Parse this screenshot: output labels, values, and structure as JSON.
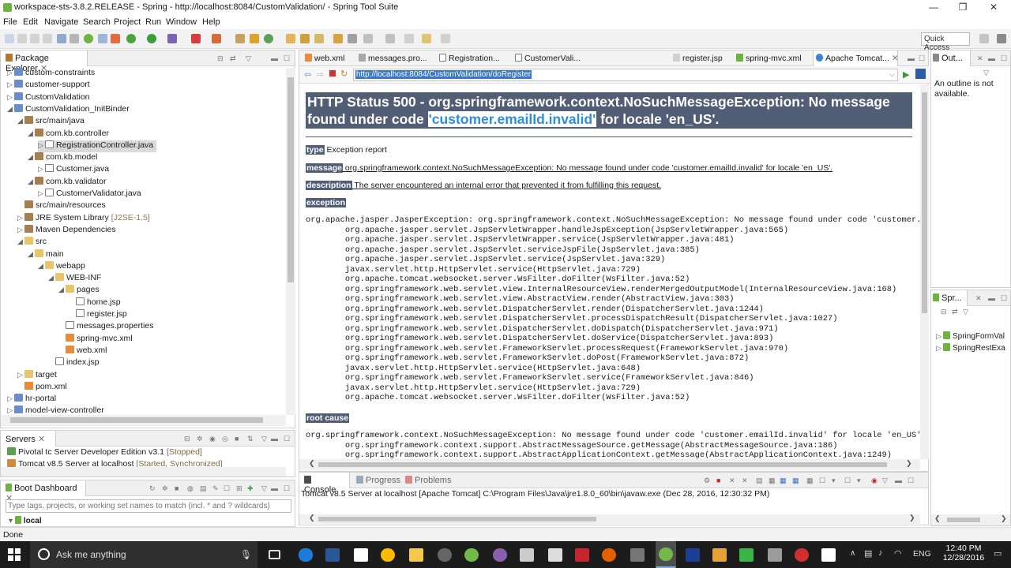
{
  "window": {
    "title": "workspace-sts-3.8.2.RELEASE - Spring - http://localhost:8084/CustomValidation/ - Spring Tool Suite"
  },
  "menu": [
    "File",
    "Edit",
    "Navigate",
    "Search",
    "Project",
    "Run",
    "Window",
    "Help"
  ],
  "toolbar": {
    "quick_access": "Quick Access"
  },
  "package_explorer": {
    "title": "Package Explorer",
    "items": [
      {
        "label": "custom-constraints",
        "depth": 0,
        "icon": "project-icon",
        "tw": "▷"
      },
      {
        "label": "customer-support",
        "depth": 0,
        "icon": "project-icon",
        "tw": "▷"
      },
      {
        "label": "CustomValidation",
        "depth": 0,
        "icon": "project-icon",
        "tw": "▷"
      },
      {
        "label": "CustomValidation_InitBinder",
        "depth": 0,
        "icon": "project-icon",
        "tw": "◢"
      },
      {
        "label": "src/main/java",
        "depth": 1,
        "icon": "source-folder-icon",
        "tw": "◢"
      },
      {
        "label": "com.kb.controller",
        "depth": 2,
        "icon": "package-icon",
        "tw": "◢"
      },
      {
        "label": "RegistrationController.java",
        "depth": 3,
        "icon": "java-file-icon",
        "tw": "▷",
        "selected": true
      },
      {
        "label": "com.kb.model",
        "depth": 2,
        "icon": "package-icon",
        "tw": "◢"
      },
      {
        "label": "Customer.java",
        "depth": 3,
        "icon": "java-file-icon",
        "tw": "▷"
      },
      {
        "label": "com.kb.validator",
        "depth": 2,
        "icon": "package-icon",
        "tw": "◢"
      },
      {
        "label": "CustomerValidator.java",
        "depth": 3,
        "icon": "java-file-icon",
        "tw": "▷"
      },
      {
        "label": "src/main/resources",
        "depth": 1,
        "icon": "source-folder-icon",
        "tw": ""
      },
      {
        "label": "JRE System Library",
        "suffix": "[J2SE-1.5]",
        "depth": 1,
        "icon": "library-icon",
        "tw": "▷"
      },
      {
        "label": "Maven Dependencies",
        "depth": 1,
        "icon": "library-icon",
        "tw": "▷"
      },
      {
        "label": "src",
        "depth": 1,
        "icon": "folder-icon",
        "tw": "◢"
      },
      {
        "label": "main",
        "depth": 2,
        "icon": "folder-icon",
        "tw": "◢"
      },
      {
        "label": "webapp",
        "depth": 3,
        "icon": "folder-icon",
        "tw": "◢"
      },
      {
        "label": "WEB-INF",
        "depth": 4,
        "icon": "folder-icon",
        "tw": "◢"
      },
      {
        "label": "pages",
        "depth": 5,
        "icon": "folder-icon",
        "tw": "◢"
      },
      {
        "label": "home.jsp",
        "depth": 6,
        "icon": "jsp-file-icon",
        "tw": ""
      },
      {
        "label": "register.jsp",
        "depth": 6,
        "icon": "jsp-file-icon",
        "tw": ""
      },
      {
        "label": "messages.properties",
        "depth": 5,
        "icon": "properties-file-icon",
        "tw": ""
      },
      {
        "label": "spring-mvc.xml",
        "depth": 5,
        "icon": "xml-file-icon",
        "tw": ""
      },
      {
        "label": "web.xml",
        "depth": 5,
        "icon": "xml-file-icon",
        "tw": ""
      },
      {
        "label": "index.jsp",
        "depth": 4,
        "icon": "jsp-file-icon",
        "tw": ""
      },
      {
        "label": "target",
        "depth": 1,
        "icon": "folder-icon",
        "tw": "▷"
      },
      {
        "label": "pom.xml",
        "depth": 1,
        "icon": "xml-file-icon",
        "tw": ""
      },
      {
        "label": "hr-portal",
        "depth": 0,
        "icon": "project-icon",
        "tw": "▷"
      },
      {
        "label": "model-view-controller",
        "depth": 0,
        "icon": "project-icon",
        "tw": "▷"
      }
    ]
  },
  "servers": {
    "title": "Servers",
    "items": [
      {
        "label": "Pivotal tc Server Developer Edition v3.1",
        "status": "[Stopped]"
      },
      {
        "label": "Tomcat v8.5 Server at localhost",
        "status": "[Started, Synchronized]"
      }
    ]
  },
  "boot_dashboard": {
    "title": "Boot Dashboard",
    "filter_placeholder": "Type tags, projects, or working set names to match (incl. * and ? wildcards)",
    "item": "local"
  },
  "editor": {
    "tabs": [
      "web.xml",
      "messages.pro...",
      "Registration...",
      "CustomerVali...",
      "register.jsp",
      "spring-mvc.xml",
      "Apache Tomcat..."
    ],
    "url": "http://localhost:8084/CustomValidation/doRegister",
    "heading_pre": "HTTP Status 500 - org.springframework.context.NoSuchMessageException: No message found under code ",
    "heading_code": "'customer.emailId.invalid'",
    "heading_post": " for locale 'en_US'.",
    "type_label": "type",
    "type_value": " Exception report",
    "message_label": "message",
    "message_value": " org.springframework.context.NoSuchMessageException: No message found under code 'customer.emailId.invalid' for locale 'en_US'.",
    "description_label": "description",
    "description_value": " The server encountered an internal error that prevented it from fulfilling this request.",
    "exception_label": "exception",
    "exception_trace": "org.apache.jasper.JasperException: org.springframework.context.NoSuchMessageException: No message found under code 'customer.emailId.invalid' for locale 'en_US'.\n\torg.apache.jasper.servlet.JspServletWrapper.handleJspException(JspServletWrapper.java:565)\n\torg.apache.jasper.servlet.JspServletWrapper.service(JspServletWrapper.java:481)\n\torg.apache.jasper.servlet.JspServlet.serviceJspFile(JspServlet.java:385)\n\torg.apache.jasper.servlet.JspServlet.service(JspServlet.java:329)\n\tjavax.servlet.http.HttpServlet.service(HttpServlet.java:729)\n\torg.apache.tomcat.websocket.server.WsFilter.doFilter(WsFilter.java:52)\n\torg.springframework.web.servlet.view.InternalResourceView.renderMergedOutputModel(InternalResourceView.java:168)\n\torg.springframework.web.servlet.view.AbstractView.render(AbstractView.java:303)\n\torg.springframework.web.servlet.DispatcherServlet.render(DispatcherServlet.java:1244)\n\torg.springframework.web.servlet.DispatcherServlet.processDispatchResult(DispatcherServlet.java:1027)\n\torg.springframework.web.servlet.DispatcherServlet.doDispatch(DispatcherServlet.java:971)\n\torg.springframework.web.servlet.DispatcherServlet.doService(DispatcherServlet.java:893)\n\torg.springframework.web.servlet.FrameworkServlet.processRequest(FrameworkServlet.java:970)\n\torg.springframework.web.servlet.FrameworkServlet.doPost(FrameworkServlet.java:872)\n\tjavax.servlet.http.HttpServlet.service(HttpServlet.java:648)\n\torg.springframework.web.servlet.FrameworkServlet.service(FrameworkServlet.java:846)\n\tjavax.servlet.http.HttpServlet.service(HttpServlet.java:729)\n\torg.apache.tomcat.websocket.server.WsFilter.doFilter(WsFilter.java:52)",
    "root_cause_label": "root cause",
    "root_trace": "org.springframework.context.NoSuchMessageException: No message found under code 'customer.emailId.invalid' for locale 'en_US'.\n\torg.springframework.context.support.AbstractMessageSource.getMessage(AbstractMessageSource.java:186)\n\torg.springframework.context.support.AbstractApplicationContext.getMessage(AbstractApplicationContext.java:1249)"
  },
  "outline": {
    "title": "Out...",
    "text": "An outline is not available."
  },
  "spring_panel": {
    "title": "Spr...",
    "items": [
      "SpringFormVal",
      "SpringRestExa"
    ]
  },
  "console": {
    "tabs": [
      "Console",
      "Progress",
      "Problems"
    ],
    "text": "Tomcat v8.5 Server at localhost [Apache Tomcat] C:\\Program Files\\Java\\jre1.8.0_60\\bin\\javaw.exe (Dec 28, 2016, 12:30:32 PM)"
  },
  "status": {
    "text": "Done"
  },
  "taskbar": {
    "search": "Ask me anything",
    "lang": "ENG",
    "time": "12:40 PM",
    "date": "12/28/2016"
  },
  "colors": {
    "heading_bg": "#525d76",
    "accent": "#2e8fd6",
    "taskbar": "#1c1c1c"
  }
}
